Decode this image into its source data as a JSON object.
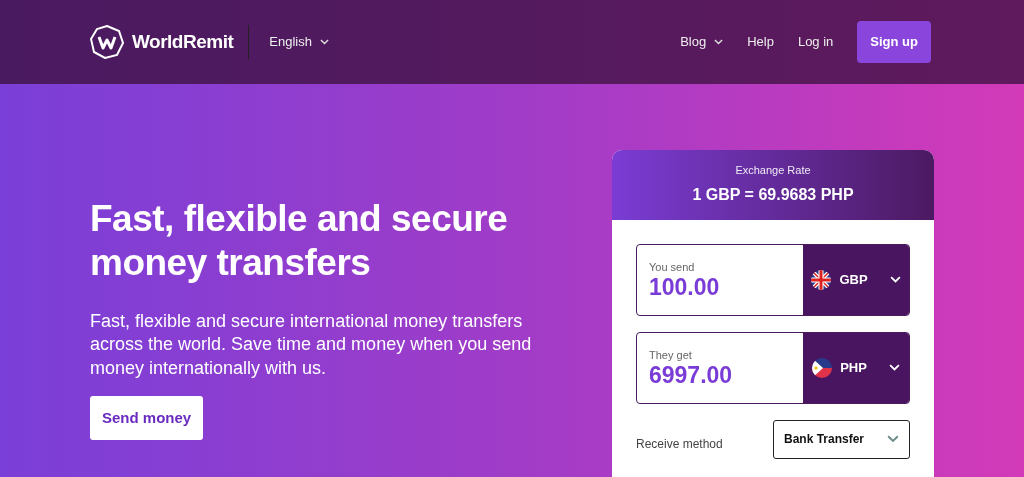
{
  "header": {
    "brand": "WorldRemit",
    "language": "English",
    "nav": [
      {
        "label": "Blog",
        "has_menu": true
      },
      {
        "label": "Help",
        "has_menu": false
      },
      {
        "label": "Log in",
        "has_menu": false
      }
    ],
    "signup": "Sign up"
  },
  "hero": {
    "title": "Fast, flexible and secure money transfers",
    "text": "Fast, flexible and secure international money transfers across the world. Save time and money when you send money internationally with us.",
    "cta": "Send money"
  },
  "converter": {
    "rate_label": "Exchange Rate",
    "rate": "1 GBP = 69.9683 PHP",
    "amounts": [
      {
        "label": "You send",
        "value": "100.00",
        "currency": "GBP",
        "kind": "gb"
      },
      {
        "label": "They get",
        "value": "6997.00",
        "currency": "PHP",
        "kind": "ph"
      }
    ],
    "receive_label": "Receive method",
    "receive_value": "Bank Transfer"
  }
}
